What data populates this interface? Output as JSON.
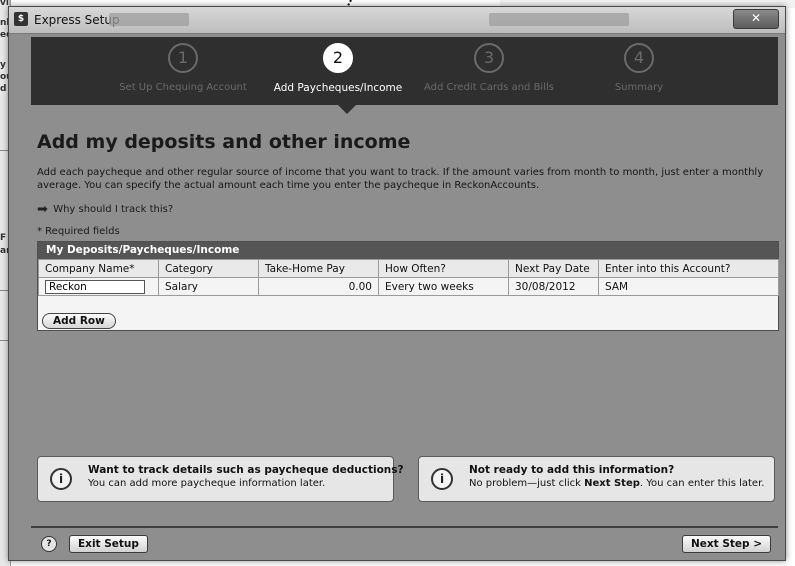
{
  "background": {
    "fragments": [
      "ving:",
      "nk",
      "eq",
      "y",
      "ou",
      "d e",
      "F t",
      "an"
    ]
  },
  "window": {
    "icon_letter": "$",
    "title": "Express Setup",
    "close_glyph": "✕"
  },
  "steps": [
    {
      "number": "1",
      "label": "Set Up Chequing Account"
    },
    {
      "number": "2",
      "label": "Add Paycheques/Income"
    },
    {
      "number": "3",
      "label": "Add Credit Cards and Bills"
    },
    {
      "number": "4",
      "label": "Summary"
    }
  ],
  "active_step": 2,
  "page": {
    "title": "Add my deposits and other income",
    "description": "Add each paycheque and other regular source of income that you want to track. If the amount varies from month to month, just enter a monthly average. You can specify the actual amount each time you enter the paycheque in ReckonAccounts.",
    "why_link": "Why should I track this?",
    "required_note": "* Required fields"
  },
  "grid": {
    "title": "My Deposits/Paycheques/Income",
    "columns": [
      "Company Name*",
      "Category",
      "Take-Home Pay",
      "How Often?",
      "Next Pay Date",
      "Enter into this Account?"
    ],
    "rows": [
      {
        "company": "Reckon",
        "category": "Salary",
        "pay": "0.00",
        "often": "Every two weeks",
        "next_date": "30/08/2012",
        "account": "SAM"
      }
    ],
    "add_row_label": "Add Row"
  },
  "info_left": {
    "title": "Want to track details such as paycheque deductions?",
    "body": "You can add more paycheque information later."
  },
  "info_right": {
    "title": "Not ready to add this information?",
    "body_pre": "No problem—just click ",
    "body_bold": "Next Step",
    "body_post": ". You can enter this later."
  },
  "footer": {
    "help_glyph": "?",
    "exit_label": "Exit Setup",
    "next_label": "Next Step >"
  },
  "icons": {
    "info": "info-icon",
    "help": "help-icon",
    "arrow": "right-arrow-icon"
  }
}
